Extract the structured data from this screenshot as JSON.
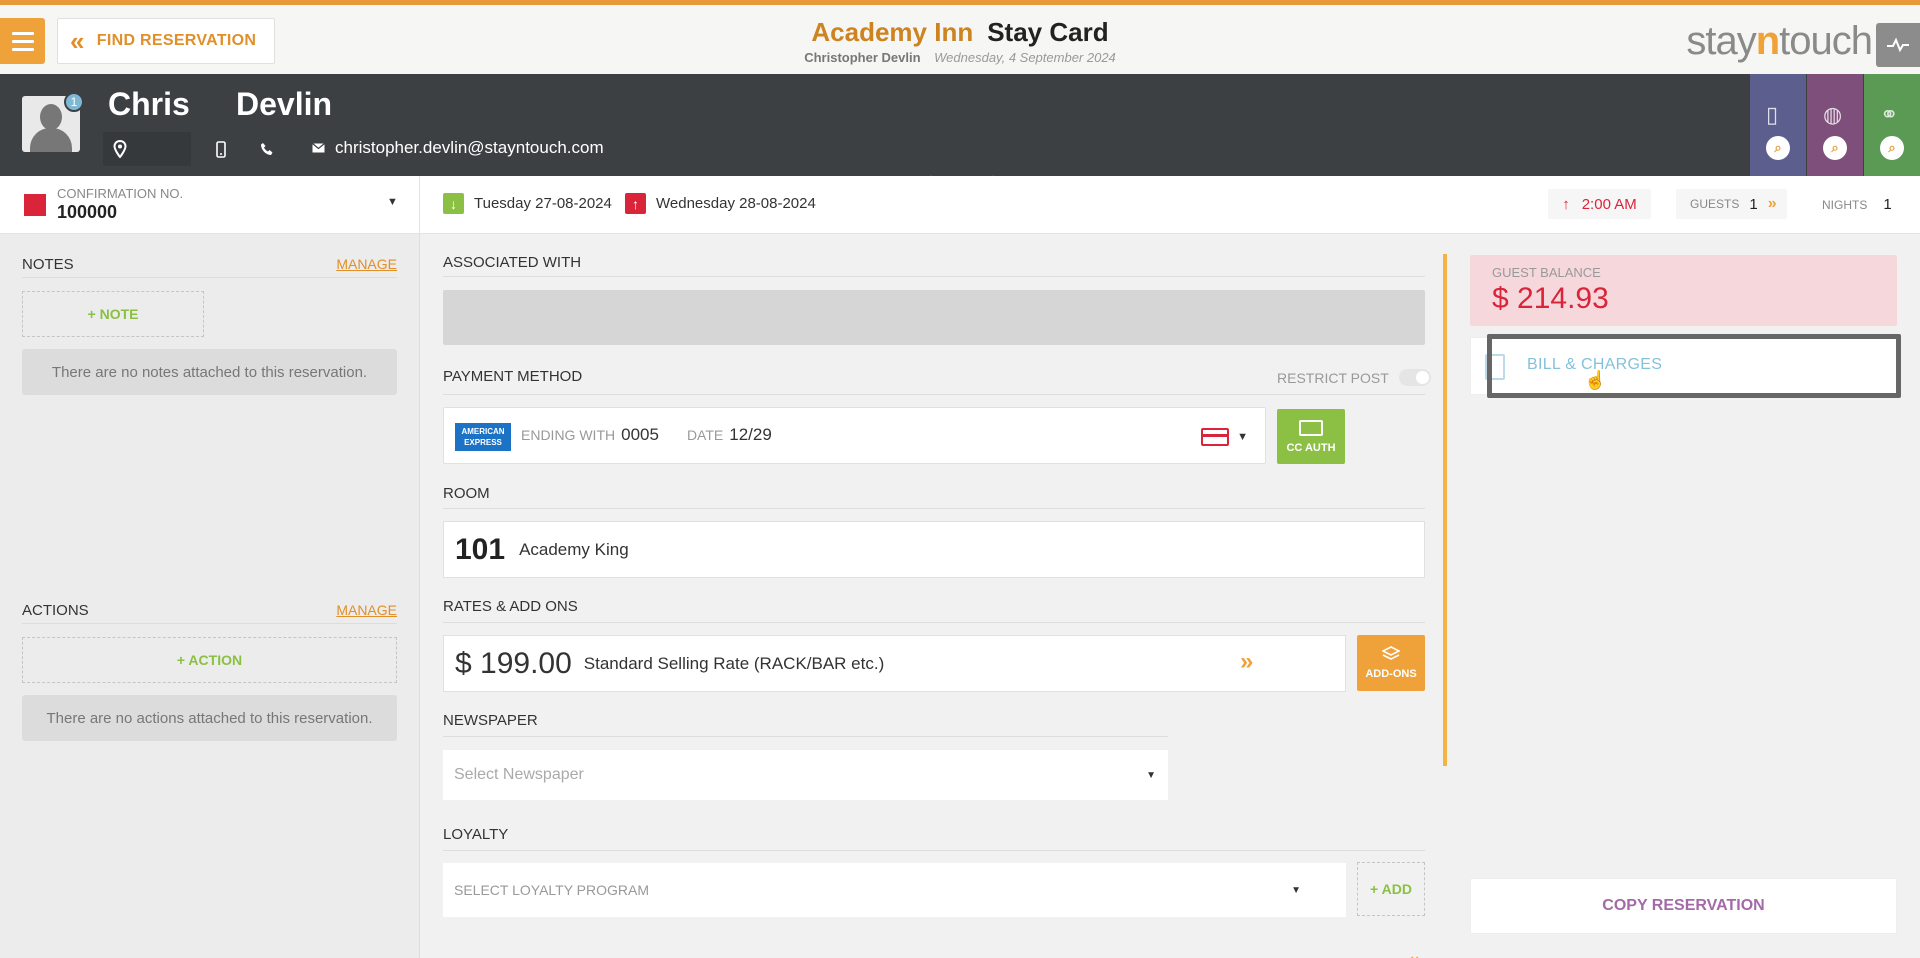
{
  "topbar": {
    "find_label": "FIND RESERVATION",
    "hotel_name": "Academy Inn",
    "page_title": "Stay Card",
    "user_name": "Christopher Devlin",
    "business_date": "Wednesday, 4 September 2024",
    "logo_pre": "stay",
    "logo_n": "n",
    "logo_post": "touch"
  },
  "guest": {
    "first_name": "Chris",
    "last_name": "Devlin",
    "badge_count": "1",
    "email": "christopher.devlin@stayntouch.com",
    "tab_colors": [
      "#5c5f8e",
      "#7e4f7a",
      "#5a9a55"
    ]
  },
  "reservation": {
    "confirmation_label": "CONFIRMATION NO.",
    "confirmation_number": "100000",
    "arrival_date": "Tuesday 27-08-2024",
    "departure_date": "Wednesday 28-08-2024",
    "departure_time": "2:00 AM",
    "guests_label": "GUESTS",
    "guests_count": "1",
    "nights_label": "NIGHTS",
    "nights_count": "1"
  },
  "notes": {
    "title": "NOTES",
    "manage_label": "MANAGE",
    "add_label": "+ NOTE",
    "empty_text": "There are no notes attached to this reservation."
  },
  "actions": {
    "title": "ACTIONS",
    "manage_label": "MANAGE",
    "add_label": "+ ACTION",
    "empty_text": "There are no actions attached to this reservation."
  },
  "main": {
    "associated_label": "ASSOCIATED WITH",
    "payment_label": "PAYMENT METHOD",
    "restrict_post_label": "RESTRICT POST",
    "card_brand_line1": "AMERICAN",
    "card_brand_line2": "EXPRESS",
    "ending_with_label": "ENDING WITH",
    "ending_with_value": "0005",
    "date_label": "DATE",
    "date_value": "12/29",
    "cc_auth_label": "CC AUTH",
    "room_label": "ROOM",
    "room_number": "101",
    "room_type": "Academy King",
    "rates_label": "RATES & ADD ONS",
    "rate_amount": "$ 199.00",
    "rate_name": "Standard Selling Rate (RACK/BAR etc.)",
    "addons_label": "ADD-ONS",
    "newspaper_label": "NEWSPAPER",
    "newspaper_placeholder": "Select Newspaper",
    "loyalty_label": "LOYALTY",
    "loyalty_placeholder": "SELECT LOYALTY PROGRAM",
    "loyalty_add_label": "+ ADD"
  },
  "right": {
    "balance_label": "GUEST BALANCE",
    "balance_value": "$ 214.93",
    "bill_label": "BILL & CHARGES",
    "copy_label": "COPY RESERVATION"
  },
  "colors": {
    "accent_orange": "#f0a23a",
    "header_dark": "#3d4043",
    "alert_red": "#d9243a",
    "success_green": "#8cc044"
  }
}
